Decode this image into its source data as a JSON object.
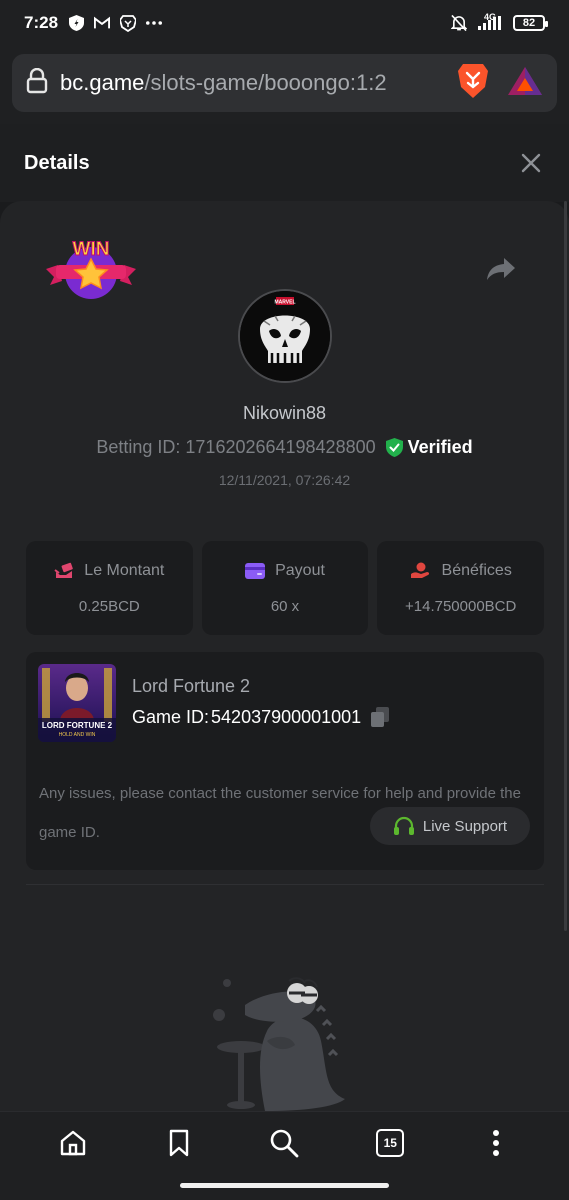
{
  "status_bar": {
    "time": "7:28",
    "network": "4G",
    "battery": "82",
    "icons": [
      "shield-icon",
      "gmail-icon",
      "brave-icon",
      "more-dots-icon",
      "mute-bell-icon",
      "signal-icon",
      "battery-icon"
    ]
  },
  "browser": {
    "url_domain": "bc.game",
    "url_path": "/slots-game/booongo:1:2",
    "icons": [
      "lock-icon",
      "brave-lion-icon",
      "bat-rewards-icon"
    ]
  },
  "header": {
    "title": "Details"
  },
  "bet": {
    "badge": "WIN",
    "avatar_caption": "MARVEL",
    "username": "Nikowin88",
    "betting_id_label": "Betting ID:",
    "betting_id": "1716202664198428800",
    "verified_label": "Verified",
    "timestamp": "12/11/2021, 07:26:42"
  },
  "stats": [
    {
      "label": "Le Montant",
      "value": "0.25BCD",
      "icon": "hand-money-icon",
      "color": "#e0466e"
    },
    {
      "label": "Payout",
      "value": "60 x",
      "icon": "wallet-card-icon",
      "color": "#8b5cf6"
    },
    {
      "label": "Bénéfices",
      "value": "+14.750000BCD",
      "icon": "profit-hand-icon",
      "color": "#e0463f"
    }
  ],
  "game": {
    "name": "Lord Fortune 2",
    "id_label": "Game ID:",
    "id": "542037900001001",
    "thumb_title": "LORD FORTUNE 2",
    "thumb_subtitle": "HOLD AND WIN",
    "issue_text": "Any issues, please contact the customer service for help and provide the game ID.",
    "support_label": "Live Support",
    "support_color": "#5cb82e"
  },
  "nav": {
    "tab_count": "15",
    "items": [
      "home-icon",
      "bookmark-icon",
      "search-icon",
      "tabs-icon",
      "menu-dots-icon"
    ]
  }
}
